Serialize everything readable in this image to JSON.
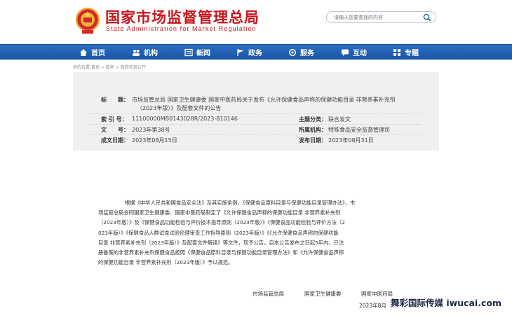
{
  "header": {
    "title_cn": "国家市场监督管理总局",
    "title_en": "State Administration for Market Regulation",
    "search_placeholder": "请输入您要查找的内容"
  },
  "nav": [
    {
      "label": "首页",
      "icon": "home-icon"
    },
    {
      "label": "机构",
      "icon": "people-icon"
    },
    {
      "label": "新闻",
      "icon": "news-icon"
    },
    {
      "label": "政务",
      "icon": "flag-icon"
    },
    {
      "label": "服务",
      "icon": "service-icon"
    },
    {
      "label": "互动",
      "icon": "chat-icon"
    },
    {
      "label": "专题",
      "icon": "grid-icon"
    }
  ],
  "breadcrumb": "你的位置:首页 > 政务 > 政府信息公开",
  "meta": {
    "title_label": "标　　题：",
    "title_line1": "市场监管总局 国家卫生健康委 国家中医药局关于发布《允许保健食品声称的保健功能目录 非营养素补充剂",
    "title_line2": "（2023年版）》及配套文件的公告",
    "index_label": "索 引 号：",
    "index_value": "11100000MB0143028R/2023-810146",
    "category_label": "主题分类：",
    "category_value": "联合发文",
    "doc_label": "文　　号：",
    "doc_value": "2023年第38号",
    "org_label": "所属机构：",
    "org_value": "特殊食品安全监督管理司",
    "created_label": "成文日期：",
    "created_value": "2023年08月15日",
    "published_label": "发布日期：",
    "published_value": "2023年08月31日"
  },
  "article": {
    "lines": [
      "根据《中华人民共和国食品安全法》及其实施条例、《保健食品原料目录与保健功能目录管理办法》，市",
      "场监管总局会同国家卫生健康委、国家中医药局制定了《允许保健食品声称的保健功能目录 非营养素补充剂",
      "（2023年版）》及《保健食品功能检验与评价技术指导原则（2023年版）》《保健食品功能检验与评价方法（2",
      "023年版）》《保健食品人群试食试验伦理审查工作指导原则（2023年版）》《《允许保健食品声称的保健功能",
      "目录 非营养素补充剂（2023年版）》及配套文件解读》等文件，现予公告。自本公告发布之日起5年内，已注",
      "册备案的非营养素补充剂保健食品按照《保健食品原料目录与保健功能目录管理办法》和《允许保健食品声称",
      "的保健功能目录 非营养素补充剂（2023年版）》予以规范。"
    ]
  },
  "signatories": [
    "市场监管总局",
    "国家卫生健康委",
    "国家中医药局"
  ],
  "date_partial": "2023年8月",
  "watermark": "舞彩国际传媒 iwucai.com",
  "colors": {
    "brand_red": "#c8161d",
    "nav_blue": "#1f5fb3"
  }
}
